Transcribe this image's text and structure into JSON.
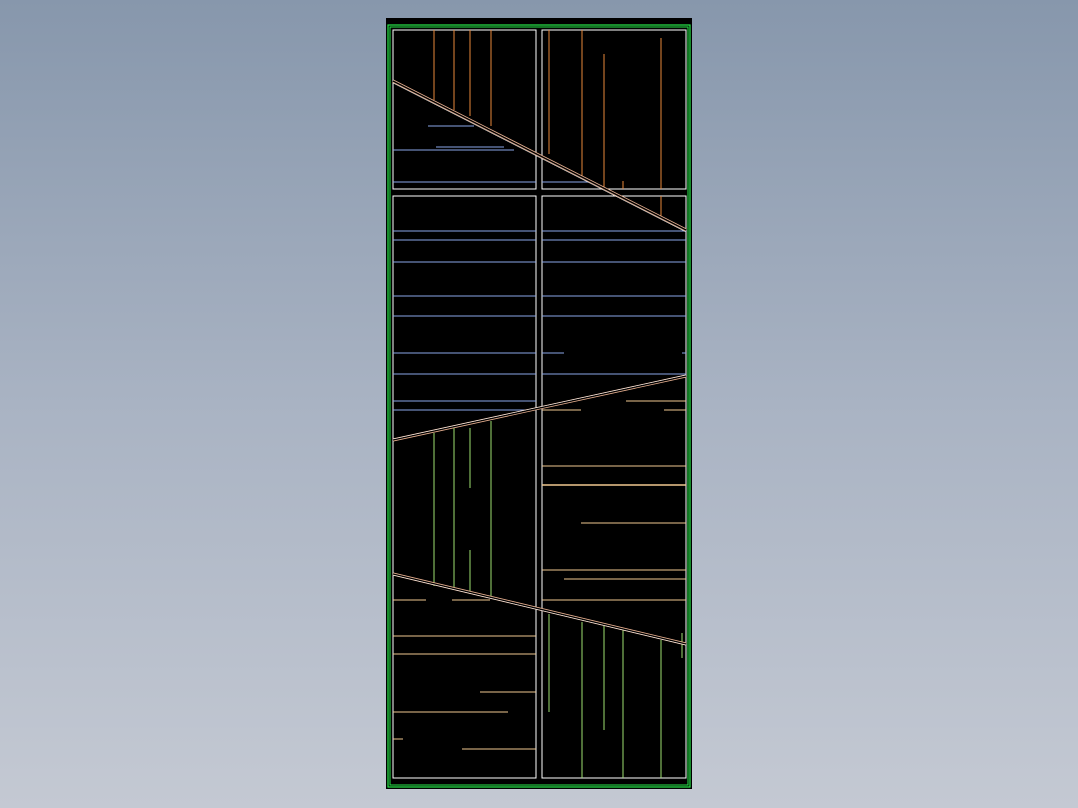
{
  "viewport": {
    "background_gradient": [
      "#8797ac",
      "#a9b3c3",
      "#c4c9d3"
    ]
  },
  "drawing": {
    "sheet_color": "#000000",
    "colors": {
      "outer_border": "#27e84a",
      "panel_border": "#ffffff",
      "orange_lines": "#e8873a",
      "blue_lines": "#8aa6e8",
      "green_lines": "#9ee070",
      "tan_lines": "#f0c890",
      "diagonal_outer": "#e8b090",
      "diagonal_inner": "#ffffff"
    },
    "panels": [
      {
        "name": "panel-top-left"
      },
      {
        "name": "panel-top-right"
      },
      {
        "name": "panel-bottom-left"
      },
      {
        "name": "panel-bottom-right"
      }
    ]
  }
}
